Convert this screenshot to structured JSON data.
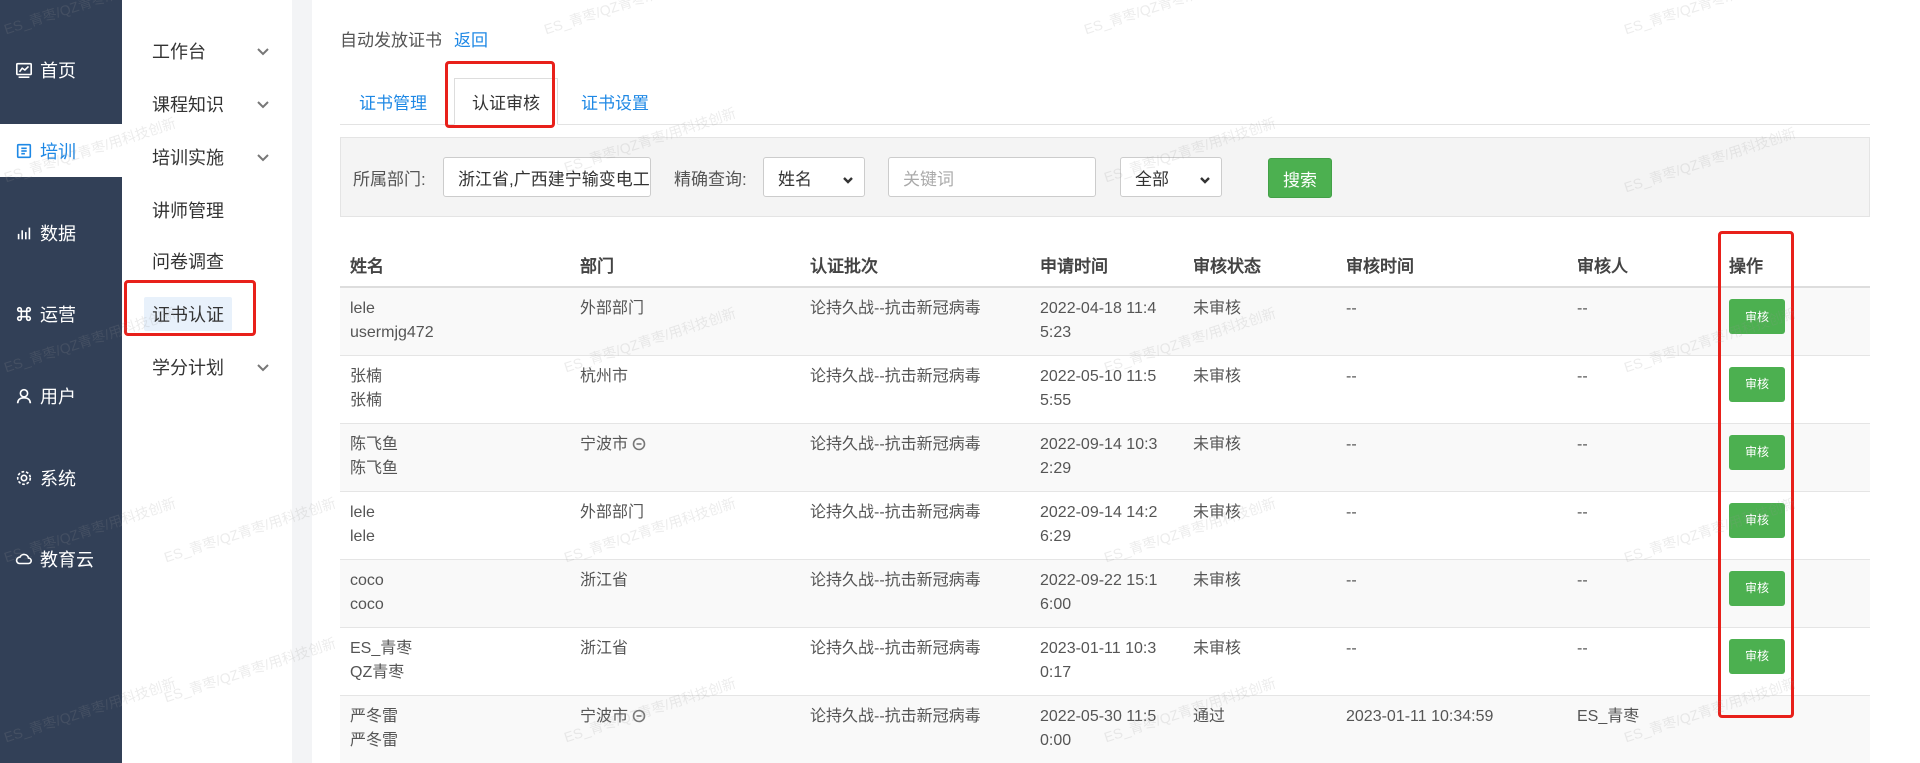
{
  "nav": {
    "items": [
      {
        "label": "首页",
        "icon": "chart-icon"
      },
      {
        "label": "培训",
        "icon": "book-icon",
        "active": true
      },
      {
        "label": "数据",
        "icon": "bar-chart-icon"
      },
      {
        "label": "运营",
        "icon": "command-icon"
      },
      {
        "label": "用户",
        "icon": "user-icon"
      },
      {
        "label": "系统",
        "icon": "gear-icon"
      },
      {
        "label": "教育云",
        "icon": "cloud-icon"
      }
    ]
  },
  "subnav": {
    "items": [
      {
        "label": "工作台",
        "expandable": true
      },
      {
        "label": "课程知识",
        "expandable": true
      },
      {
        "label": "培训实施",
        "expandable": true
      },
      {
        "label": "讲师管理",
        "expandable": false
      },
      {
        "label": "问卷调查",
        "expandable": false
      },
      {
        "label": "证书认证",
        "expandable": false,
        "active": true
      },
      {
        "label": "学分计划",
        "expandable": true
      }
    ]
  },
  "breadcrumb": {
    "title": "自动发放证书",
    "back": "返回"
  },
  "tabs": [
    {
      "label": "证书管理"
    },
    {
      "label": "认证审核",
      "active": true
    },
    {
      "label": "证书设置"
    }
  ],
  "filter": {
    "dept_label": "所属部门:",
    "dept_value": "浙江省,广西建宁输变电工",
    "query_label": "精确查询:",
    "query_field": "姓名",
    "keyword_placeholder": "关键词",
    "status_value": "全部",
    "search_label": "搜索"
  },
  "table": {
    "headers": [
      "姓名",
      "部门",
      "认证批次",
      "申请时间",
      "审核状态",
      "审核时间",
      "审核人",
      "操作"
    ],
    "action_label": "审核",
    "rows": [
      {
        "name1": "lele",
        "name2": "usermjg472",
        "dept": "外部部门",
        "dept_icon": false,
        "batch": "论持久战--抗击新冠病毒",
        "apply1": "2022-04-18 11:4",
        "apply2": "5:23",
        "status": "未审核",
        "audit_time": "--",
        "auditor": "--",
        "action": true
      },
      {
        "name1": "张楠",
        "name2": "张楠",
        "dept": "杭州市",
        "dept_icon": false,
        "batch": "论持久战--抗击新冠病毒",
        "apply1": "2022-05-10 11:5",
        "apply2": "5:55",
        "status": "未审核",
        "audit_time": "--",
        "auditor": "--",
        "action": true
      },
      {
        "name1": "陈飞鱼",
        "name2": "陈飞鱼",
        "dept": "宁波市",
        "dept_icon": true,
        "batch": "论持久战--抗击新冠病毒",
        "apply1": "2022-09-14 10:3",
        "apply2": "2:29",
        "status": "未审核",
        "audit_time": "--",
        "auditor": "--",
        "action": true
      },
      {
        "name1": "lele",
        "name2": "lele",
        "dept": "外部部门",
        "dept_icon": false,
        "batch": "论持久战--抗击新冠病毒",
        "apply1": "2022-09-14 14:2",
        "apply2": "6:29",
        "status": "未审核",
        "audit_time": "--",
        "auditor": "--",
        "action": true
      },
      {
        "name1": "coco",
        "name2": "coco",
        "dept": "浙江省",
        "dept_icon": false,
        "batch": "论持久战--抗击新冠病毒",
        "apply1": "2022-09-22 15:1",
        "apply2": "6:00",
        "status": "未审核",
        "audit_time": "--",
        "auditor": "--",
        "action": true
      },
      {
        "name1": "ES_青枣",
        "name2": "QZ青枣",
        "dept": "浙江省",
        "dept_icon": false,
        "batch": "论持久战--抗击新冠病毒",
        "apply1": "2023-01-11 10:3",
        "apply2": "0:17",
        "status": "未审核",
        "audit_time": "--",
        "auditor": "--",
        "action": true
      },
      {
        "name1": "严冬雷",
        "name2": "严冬雷",
        "dept": "宁波市",
        "dept_icon": true,
        "batch": "论持久战--抗击新冠病毒",
        "apply1": "2022-05-30 11:5",
        "apply2": "0:00",
        "status": "通过",
        "audit_time": "2023-01-11 10:34:59",
        "auditor": "ES_青枣",
        "action": false
      }
    ]
  },
  "watermark": "ES_青枣/QZ青枣/用科技创新"
}
